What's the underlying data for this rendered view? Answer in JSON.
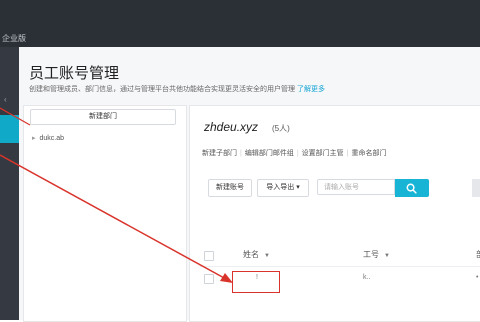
{
  "topbar": {
    "app_fragment": "企业版"
  },
  "page": {
    "title": "员工账号管理",
    "description": "创建和管理成员、部门信息，通过与管理平台共他功能结合实现更灵活安全的用户管理",
    "learn_more": "了解更多"
  },
  "left_panel": {
    "new_dept_button": "新建部门",
    "tree_item": "dukc.ab"
  },
  "right_panel": {
    "org_name": "zhdeu.xyz",
    "member_count": "(5人)",
    "actions": [
      "新建子部门",
      "编辑部门邮件组",
      "设置部门主管",
      "重命名部门"
    ],
    "add_account_button": "新建账号",
    "import_export_button": "导入导出 ▾",
    "search_placeholder": "请输入账号",
    "table": {
      "columns": [
        "姓名",
        "工号",
        "部"
      ],
      "rows": [
        {
          "name": "!",
          "id": "k..",
          "dept": "•"
        }
      ]
    }
  },
  "colors": {
    "topbar": "#2b2f36",
    "sidebar": "#353a42",
    "accent": "#18b4d6",
    "annotation": "#d9342b"
  }
}
